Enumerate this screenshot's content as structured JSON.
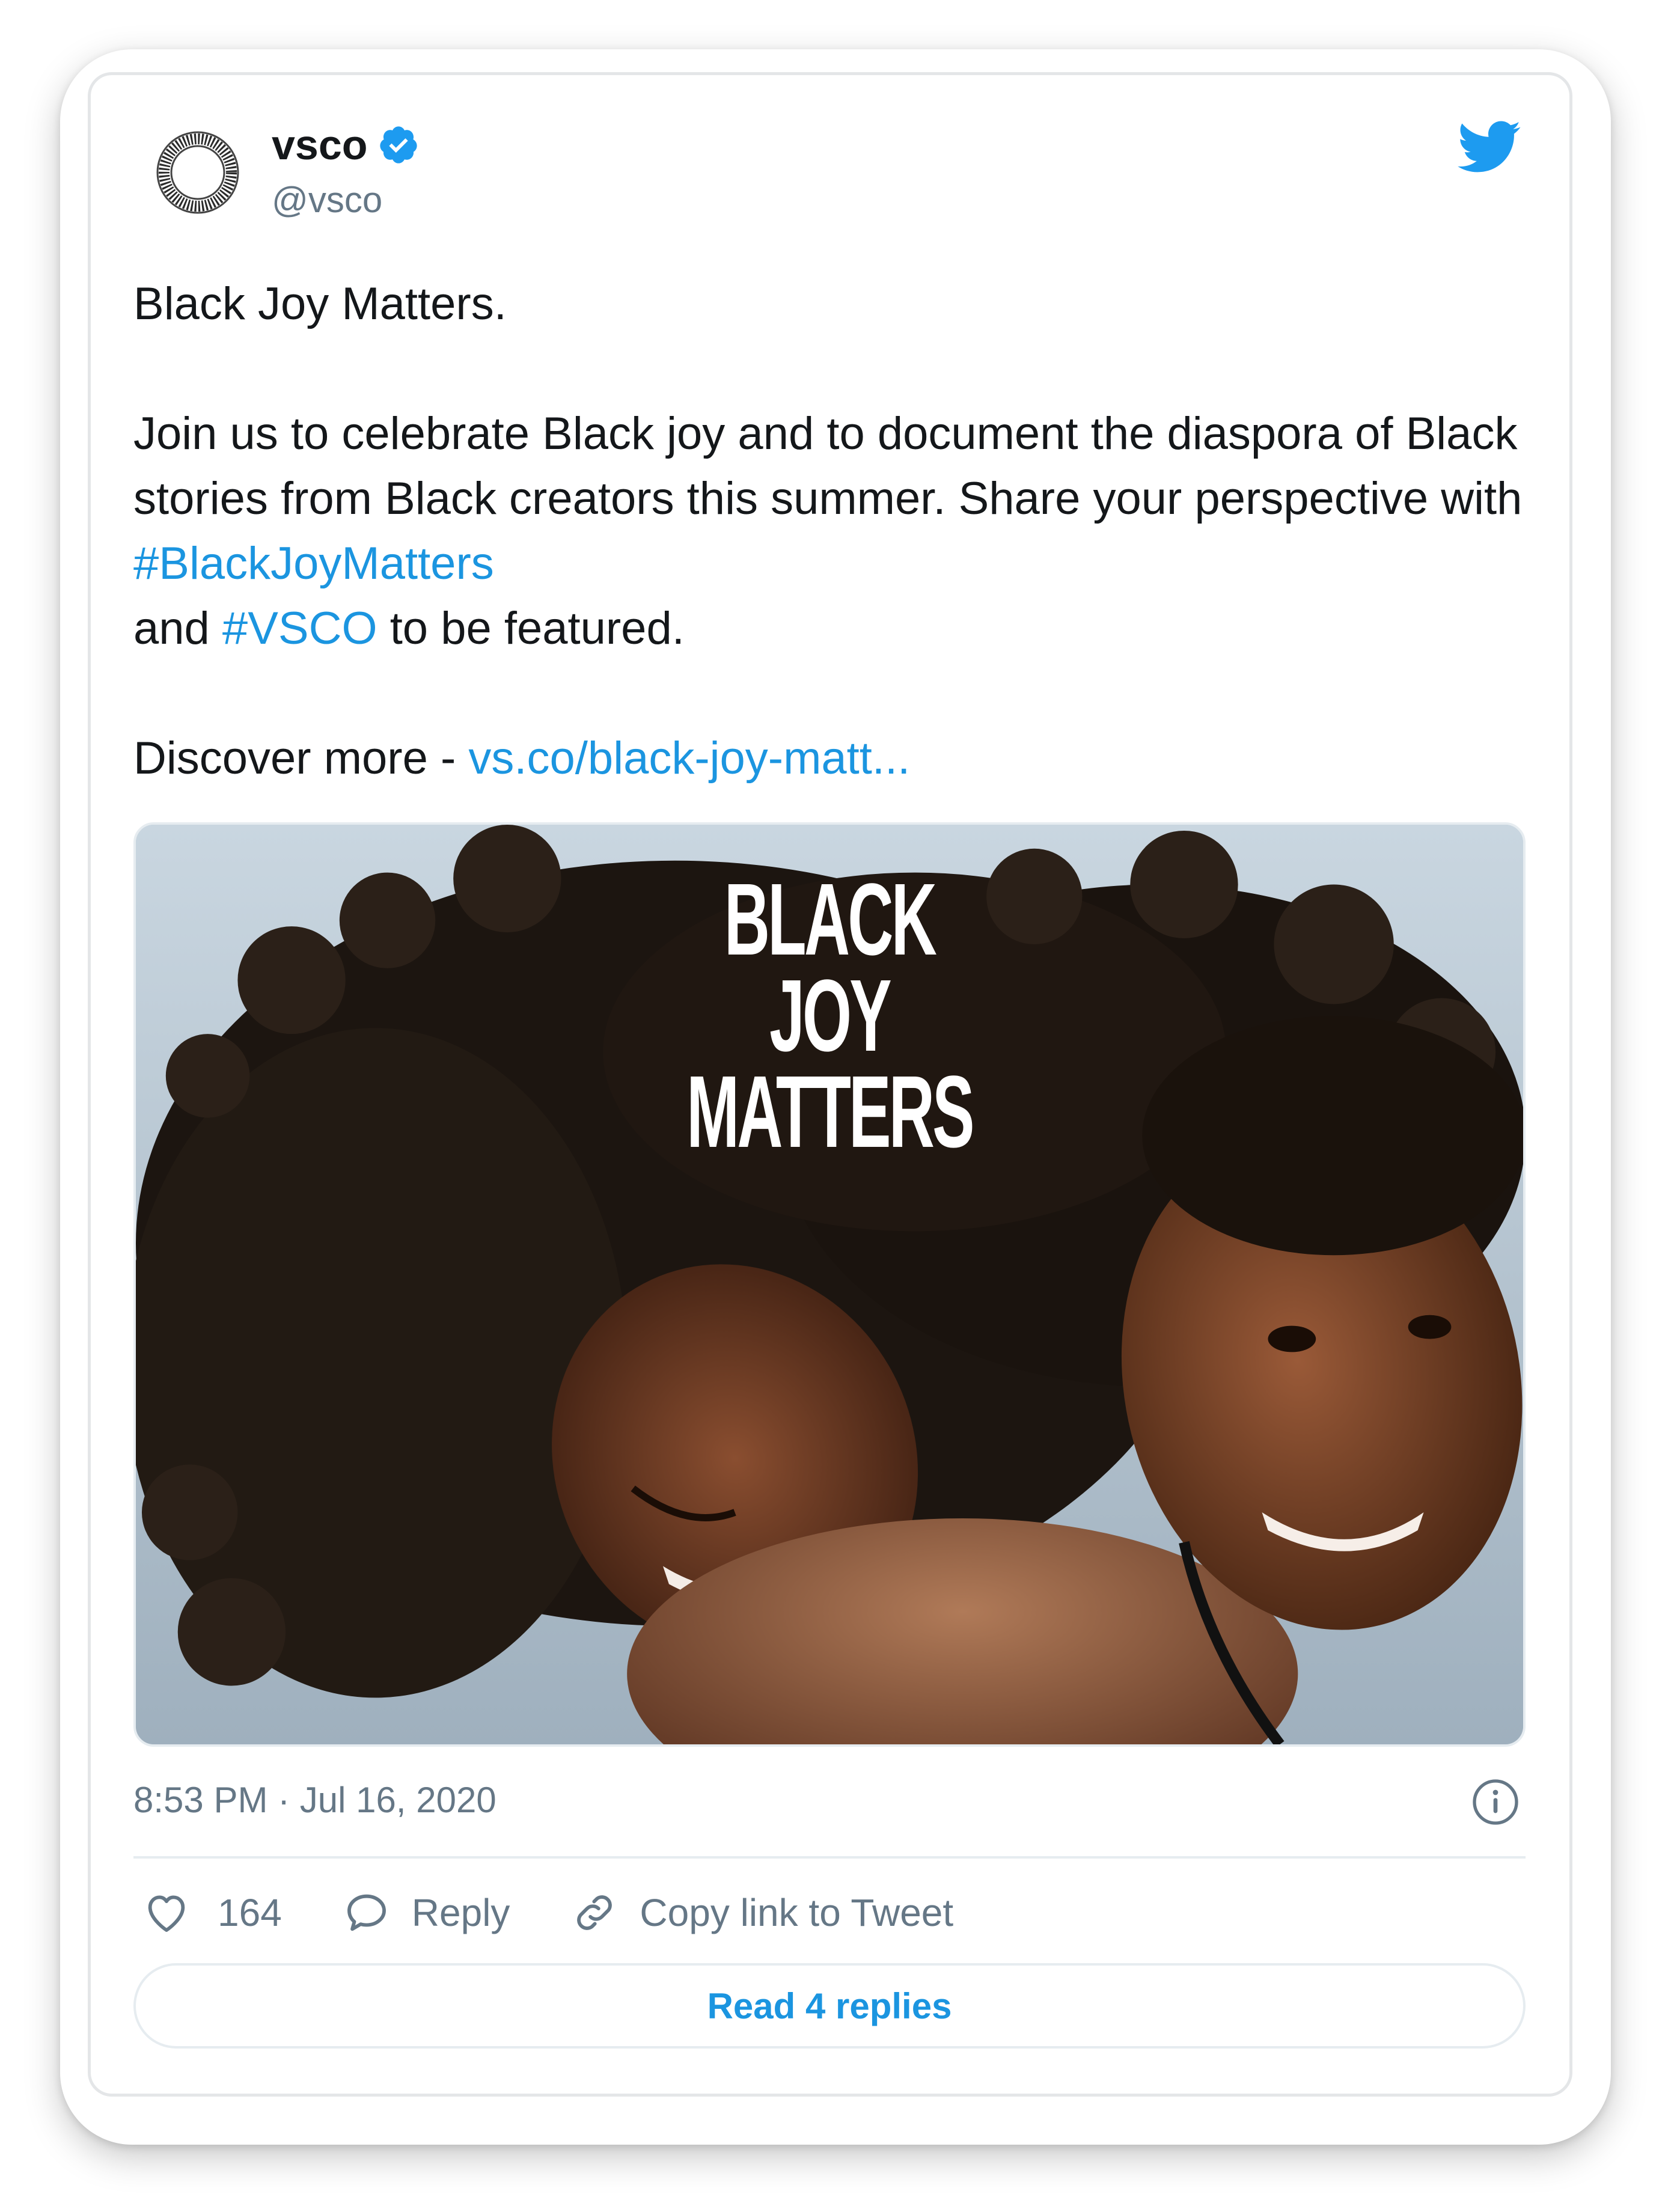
{
  "author": {
    "display_name": "vsco",
    "handle": "@vsco",
    "verified": true,
    "avatar_icon": "vsco-ring-logo-icon"
  },
  "platform_icon": "twitter-bird-icon",
  "tweet": {
    "line1": "Black Joy Matters.",
    "para2_text1": "Join us to celebrate Black joy and to document the diaspora of Black stories from Black creators this summer. Share your perspective with ",
    "hashtag1": "#BlackJoyMatters",
    "para2_text2": " and ",
    "hashtag2": "#VSCO",
    "para2_text3": " to be featured.",
    "discover_text": "Discover more - ",
    "discover_link": "vs.co/black-joy-matt..."
  },
  "media": {
    "overlay_line1": "BLACK",
    "overlay_line2": "JOY",
    "overlay_line3": "MATTERS"
  },
  "timestamp": "8:53 PM · Jul 16, 2020",
  "actions": {
    "like_count": "164",
    "reply_label": "Reply",
    "copy_label": "Copy link to Tweet",
    "read_replies_label": "Read 4 replies"
  },
  "colors": {
    "link": "#1b95e0",
    "text": "#14171a",
    "muted": "#657786",
    "border": "#e6ecf0"
  }
}
